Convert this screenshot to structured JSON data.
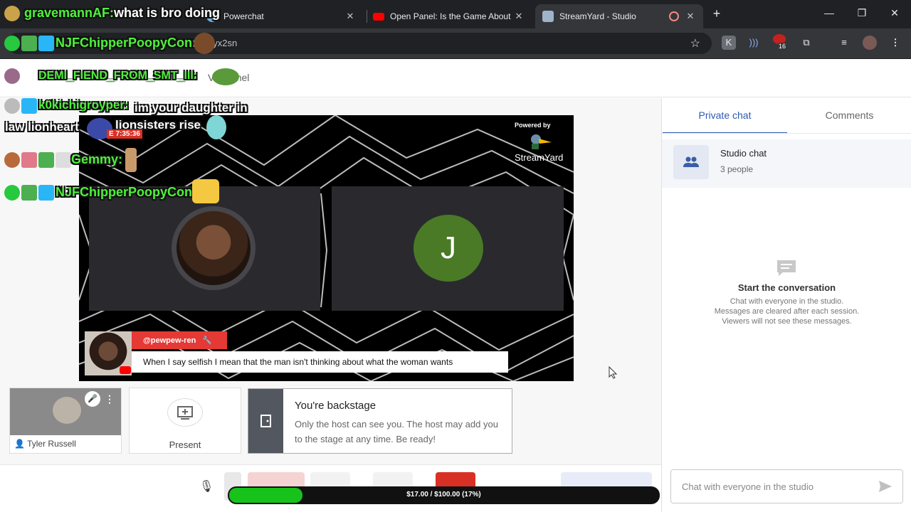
{
  "browser": {
    "tabs": [
      {
        "title": "Powerchat",
        "favicon_color": "#6ab0de"
      },
      {
        "title": "Open Panel: Is the Game About",
        "favicon_color": "#ff0000"
      },
      {
        "title": "StreamYard - Studio",
        "favicon_color": "#9fb3c8",
        "active": true
      }
    ],
    "url": "wzmyyx2sn",
    "extensions_badge": "16"
  },
  "page": {
    "title": "VS Panel"
  },
  "stage": {
    "powered_by": "Powered by",
    "brand": "StreamYard",
    "guest_initial": "J",
    "caption": {
      "name": "@pewpew-ren",
      "text": "When I say selfish I mean that the man isn't thinking about what the woman wants"
    }
  },
  "backstage": {
    "person_name": "Tyler Russell",
    "present_label": "Present",
    "title": "You're backstage",
    "text": "Only the host can see you. The host may add you to the stage at any time. Be ready!"
  },
  "right_panel": {
    "tabs": [
      "Private chat",
      "Comments"
    ],
    "studio_chat": {
      "title": "Studio chat",
      "subtitle": "3 people"
    },
    "empty": {
      "title": "Start the conversation",
      "lines": [
        "Chat with everyone in the studio.",
        "Messages are cleared after each session.",
        "Viewers will not see these messages."
      ]
    },
    "input_placeholder": "Chat with everyone in the studio"
  },
  "goal": {
    "text": "$17.00 / $100.00 (17%)",
    "progress": 0.17
  },
  "overlay": {
    "messages": [
      {
        "user": "gravemannAF:",
        "text": "what is bro doing"
      },
      {
        "user": "NJFChipperPoopyCon:",
        "text": ""
      },
      {
        "user": "DEMI_FIEND_FROM_SMT_III:",
        "text": ""
      },
      {
        "user": "k0kichigroyper:",
        "text": "im your daughter in law lionheart"
      },
      {
        "user": "",
        "text": "lionsisters rise"
      },
      {
        "user": "Gemmy:",
        "text": ""
      },
      {
        "user": "NJFChipperPoopyCon:",
        "text": ""
      }
    ],
    "timer": "E 7:35:36"
  }
}
